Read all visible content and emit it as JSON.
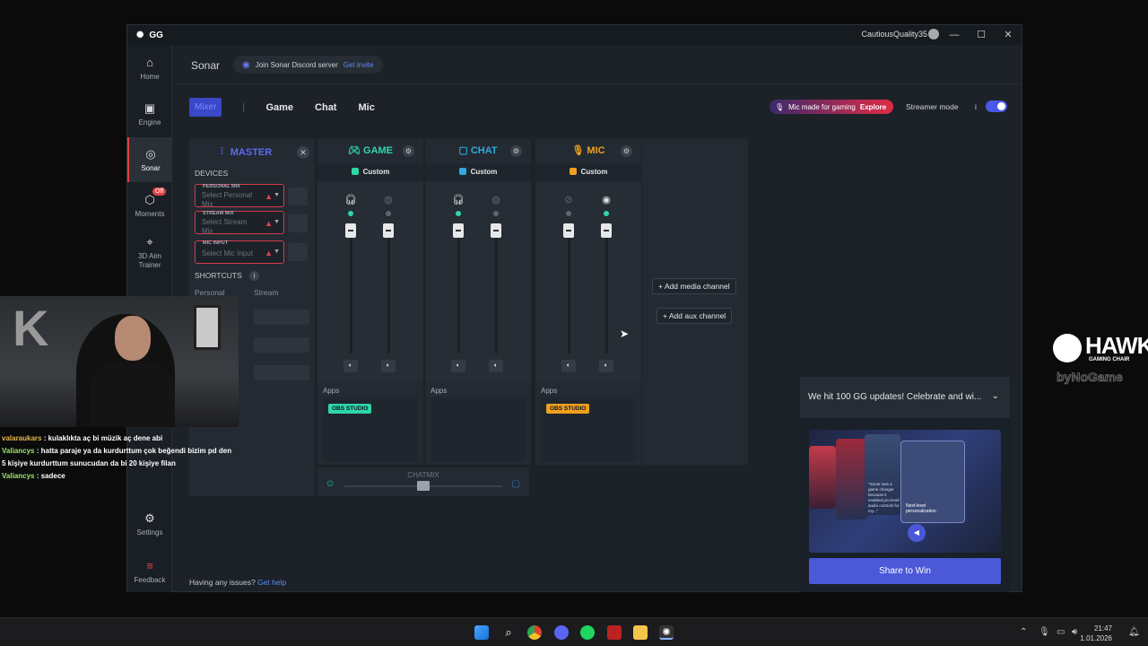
{
  "titlebar": {
    "logo": "GG",
    "username": "CautiousQuality35",
    "minimize": "—",
    "maximize": "☐",
    "close": "✕"
  },
  "sidebar": {
    "items": [
      {
        "label": "Home",
        "icon": "⌂"
      },
      {
        "label": "Engine",
        "icon": "▣"
      },
      {
        "label": "Sonar",
        "icon": "◎"
      },
      {
        "label": "Moments",
        "icon": "⬡",
        "badge": "Off"
      },
      {
        "label": "3D Aim Trainer",
        "icon": "⌖"
      },
      {
        "label": "Settings",
        "icon": "⚙"
      },
      {
        "label": "Feedback",
        "icon": "≡"
      }
    ]
  },
  "topbar": {
    "title": "Sonar",
    "discord_text": "Join Sonar Discord server",
    "discord_link": "Get invite"
  },
  "tabs": {
    "active": "Mixer",
    "items": [
      "Game",
      "Chat",
      "Mic"
    ]
  },
  "mic_promo": {
    "text": "Mic made for gaming",
    "link": "Explore"
  },
  "streamer_mode": {
    "label": "Streamer mode",
    "info": "i"
  },
  "master": {
    "title": "MASTER",
    "close": "✕",
    "devices_label": "DEVICES",
    "personal_mix": {
      "label": "PERSONAL MIX",
      "placeholder": "Select Personal Mix"
    },
    "stream_mix": {
      "label": "STREAM MIX",
      "placeholder": "Select Stream Mix"
    },
    "mic_input": {
      "label": "MIC INPUT",
      "placeholder": "Select Mic Input"
    },
    "shortcuts_label": "SHORTCUTS",
    "shortcuts_info": "i",
    "col_personal": "Personal",
    "col_stream": "Stream"
  },
  "channels": [
    {
      "name": "GAME",
      "preset": "Custom",
      "color": "#2ed7a8",
      "apps_label": "Apps",
      "app": "OBS STUDIO"
    },
    {
      "name": "CHAT",
      "preset": "Custom",
      "color": "#2fa9e0",
      "apps_label": "Apps",
      "app": ""
    },
    {
      "name": "MIC",
      "preset": "Custom",
      "color": "#f0a020",
      "apps_label": "Apps",
      "app": "OBS STUDIO"
    }
  ],
  "add_media": "+ Add media channel",
  "add_aux": "+ Add aux channel",
  "chatmix": {
    "label": "CHATMIX"
  },
  "help": {
    "text": "Having any issues?",
    "link": "Get help"
  },
  "notification": {
    "title": "We hit 100 GG updates! Celebrate and wi...",
    "button": "Share to Win",
    "promo_quote": "\"Sonar was a game changer because it enabled pro-level audio controls for my...\"",
    "promo_tag": "Next-level personalization"
  },
  "chat_overlay": [
    {
      "user": "valaraukars",
      "msg": ": kulaklıkta aç bi müzik aç dene abi",
      "color": "#e8b84a"
    },
    {
      "user": "Valiancys",
      "msg": ": hatta paraje ya da kurdurttum çok beğendi bizim pd den 5 kişiye kurdurttum sunucudan da bi 20 kişiye filan",
      "color": "#9fe56c"
    },
    {
      "user": "Valiancys",
      "msg": ": sadece",
      "color": "#9fe56c"
    }
  ],
  "hawk": {
    "brand": "HAWK",
    "sub": "GAMING CHAIR",
    "sponsor": "byNoGame"
  },
  "clock": {
    "time": "21:47",
    "date": "1.01.2026"
  }
}
